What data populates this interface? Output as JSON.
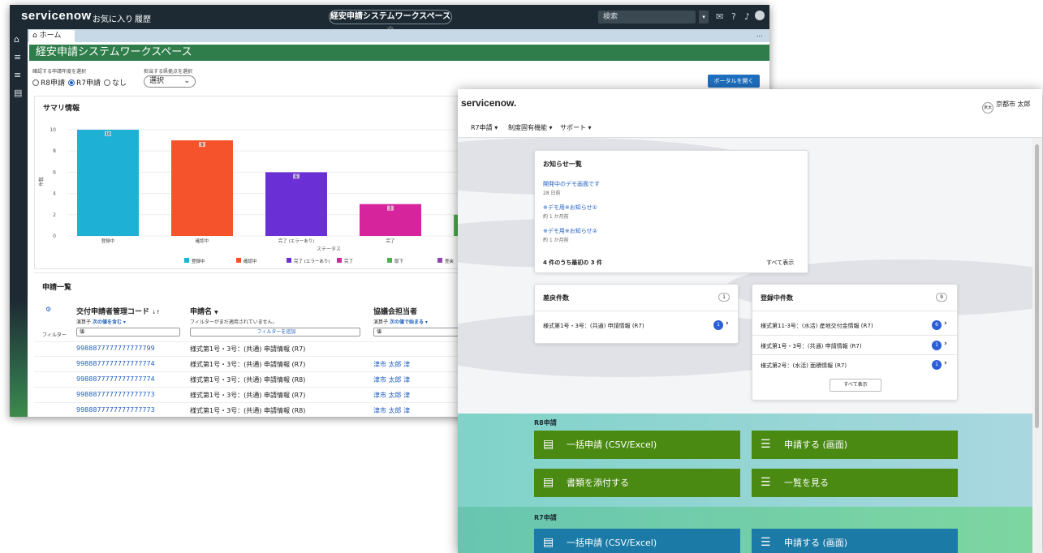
{
  "back": {
    "logo": "servicenow",
    "nav": [
      "お気に入り",
      "履歴"
    ],
    "workspace_badge": "経安申請システムワークスペース ☆",
    "search_placeholder": "検索",
    "tab_home": "ホーム",
    "tab_more": "...",
    "workspace_title": "経安申請システムワークスペース",
    "year_label": "確認する申請年度を選択",
    "year_options": [
      "R8申請",
      "R7申請",
      "なし"
    ],
    "year_selected": "R7申請",
    "office_label": "担当する県拠点を選択",
    "office_select": "選択",
    "portal_button": "ポータルを開く",
    "summary_title": "サマリ情報",
    "list_title": "申請一覧",
    "columns": [
      "交付申請者管理コード",
      "申請名",
      "協議会担当者"
    ],
    "col_sort_marks": [
      "↓↑",
      "▼"
    ],
    "operators": [
      "演算子",
      "次の値を含む",
      "フィルターがまだ適用されていません。",
      "演算子",
      "次の値で始まる"
    ],
    "filter_row_label": "フィルター",
    "filter_inputs": [
      "値",
      "値"
    ],
    "filter_button": "フィルターを追加",
    "rows": [
      {
        "code": "9988877777777777799",
        "name": "様式第1号・3号：(共通) 申請情報 (R7)",
        "person": ""
      },
      {
        "code": "9988877777777777774",
        "name": "様式第1号・3号：(共通) 申請情報 (R7)",
        "person": "津市 太郎 津"
      },
      {
        "code": "9988877777777777774",
        "name": "様式第1号・3号：(共通) 申請情報 (R8)",
        "person": "津市 太郎 津"
      },
      {
        "code": "9988877777777777773",
        "name": "様式第1号・3号：(共通) 申請情報 (R7)",
        "person": "津市 太郎 津"
      },
      {
        "code": "9988877777777777773",
        "name": "様式第1号・3号：(共通) 申請情報 (R8)",
        "person": "津市 太郎 津"
      }
    ]
  },
  "chart_data": {
    "type": "bar",
    "categories": [
      "登録中",
      "確認中",
      "完了 (エラーあり)",
      "完了",
      "取下"
    ],
    "values": [
      10,
      9,
      6,
      3,
      2
    ],
    "value_labels": [
      "10",
      "9",
      "6",
      "3",
      ""
    ],
    "colors": [
      "#1fb0d6",
      "#f4532b",
      "#6b2fd6",
      "#d6259c",
      "#4caf50"
    ],
    "xlabel": "ステータス",
    "ylabel": "件数",
    "yticks": [
      "0",
      "2",
      "4",
      "6",
      "8",
      "10"
    ],
    "ylim": [
      0,
      10
    ],
    "legend": [
      "登録中",
      "確認中",
      "完了 (エラーあり)",
      "完了",
      "取下",
      "差戻"
    ],
    "legend_colors": [
      "#1fb0d6",
      "#f4532b",
      "#6b2fd6",
      "#d6259c",
      "#4caf50",
      "#8e44ad"
    ],
    "grid": true,
    "legend_position": "bottom"
  },
  "front": {
    "logo": "servicenow.",
    "nav": [
      "R7申請 ▾",
      "制度固有機能 ▾",
      "サポート ▾"
    ],
    "user_initials": "京太",
    "user_name": "京都市 太郎",
    "news_title": "お知らせ一覧",
    "news": [
      {
        "title": "開発中のデモ画面です",
        "when": "28 日前"
      },
      {
        "title": "※デモ用※お知らせ①",
        "when": "約 1 か月前"
      },
      {
        "title": "※デモ用※お知らせ②",
        "when": "約 1 か月前"
      }
    ],
    "news_footer": "4 件のうち最初の 3 件",
    "news_all": "すべて表示",
    "returned_title": "差戻件数",
    "returned_count": "1",
    "returned_items": [
      {
        "label": "様式第1号・3号：(共通) 申請情報 (R7)",
        "count": "1"
      }
    ],
    "registering_title": "登録中件数",
    "registering_count": "9",
    "registering_items": [
      {
        "label": "様式第11-3号：(水活) 産地交付金情報 (R7)",
        "count": "6"
      },
      {
        "label": "様式第1号・3号：(共通) 申請情報 (R7)",
        "count": "1"
      },
      {
        "label": "様式第2号：(水活) 面積情報 (R7)",
        "count": "1"
      }
    ],
    "registering_all": "すべて表示",
    "r8_label": "R8申請",
    "r8_buttons": [
      "一括申請 (CSV/Excel)",
      "申請する (画面)",
      "書類を添付する",
      "一覧を見る"
    ],
    "r7_label": "R7申請",
    "r7_buttons": [
      "一括申請 (CSV/Excel)",
      "申請する (画面)"
    ]
  }
}
